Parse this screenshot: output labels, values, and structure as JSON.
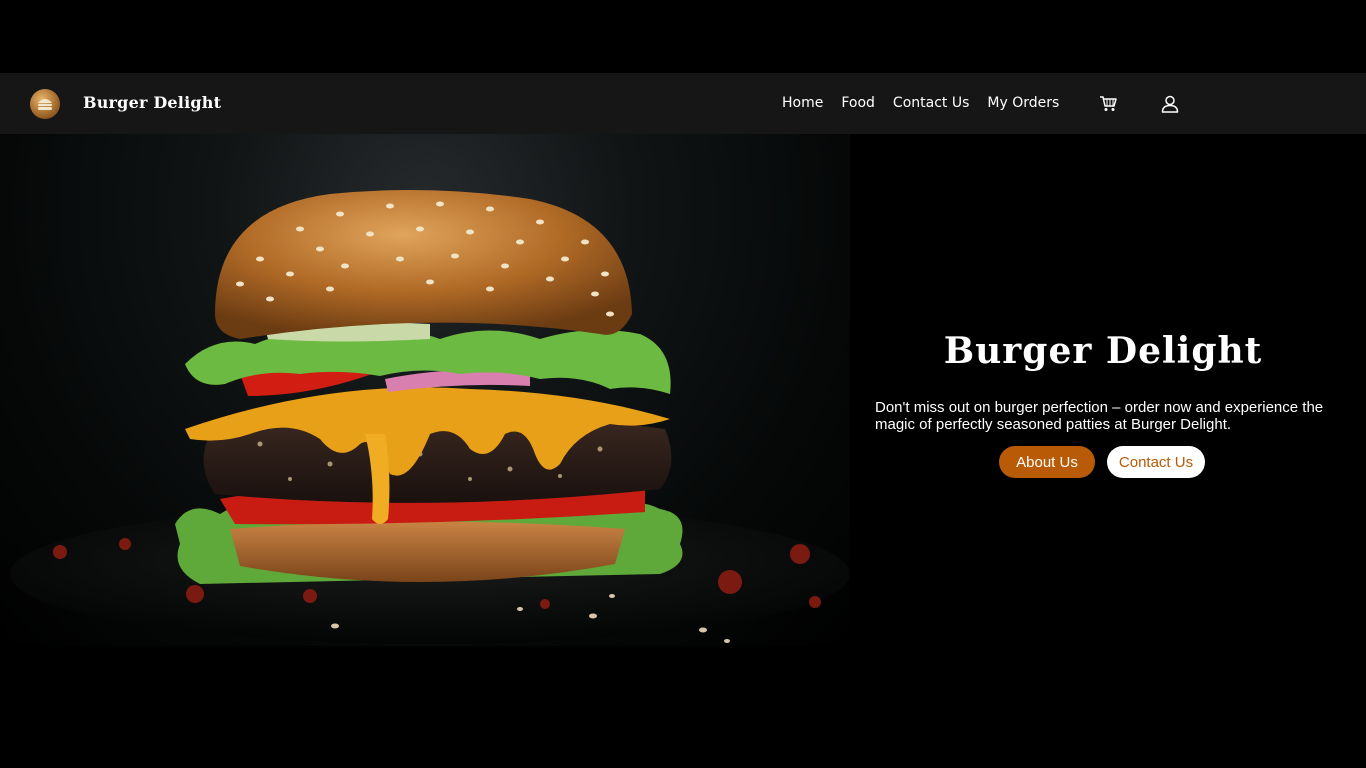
{
  "brand": {
    "name": "Burger Delight",
    "logo_icon": "burger-icon"
  },
  "nav": {
    "links": [
      "Home",
      "Food",
      "Contact Us",
      "My Orders"
    ],
    "cart_icon": "cart-icon",
    "user_icon": "user-icon"
  },
  "hero": {
    "title": "Burger Delight",
    "description": "Don't miss out on burger perfection – order now and experience the magic of perfectly seasoned patties at Burger Delight.",
    "about_button": "About Us",
    "contact_button": "Contact Us"
  },
  "colors": {
    "background": "#000000",
    "navbar": "#161616",
    "accent": "#b85a06",
    "text": "#ffffff"
  }
}
